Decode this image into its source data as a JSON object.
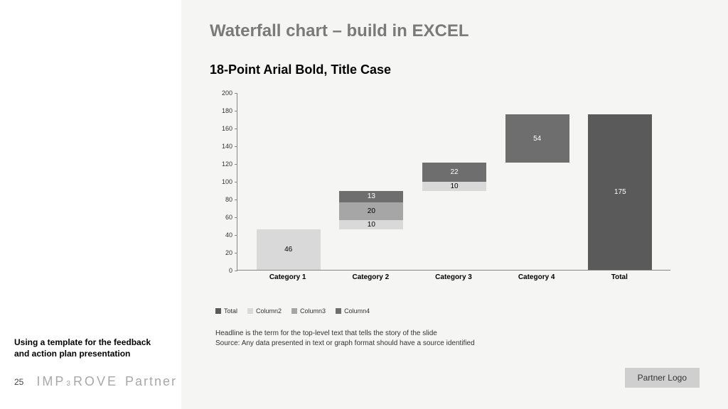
{
  "sidebar": {
    "caption": "Using a template for the feedback and action plan presentation",
    "page_number": "25",
    "brand_p1": "IMP",
    "brand_sup": "3",
    "brand_p2": "ROVE",
    "brand_partner": "Partner"
  },
  "slide": {
    "title": "Waterfall chart – build in EXCEL",
    "chart_title": "18-Point Arial Bold, Title Case",
    "headline_note": "Headline is the term for the top-level  text that tells the story of the slide",
    "source_note": "Source: Any data presented in text or graph format should have a source identified",
    "partner_logo": "Partner Logo"
  },
  "legend": {
    "items": [
      {
        "label": "Total",
        "color": "#5a5a5a"
      },
      {
        "label": "Column2",
        "color": "#d9d9d9"
      },
      {
        "label": "Column3",
        "color": "#a6a6a6"
      },
      {
        "label": "Column4",
        "color": "#6e6e6e"
      }
    ]
  },
  "chart_data": {
    "type": "bar",
    "title": "18-Point Arial Bold, Title Case",
    "xlabel": "",
    "ylabel": "",
    "ylim": [
      0,
      200
    ],
    "yticks": [
      0,
      20,
      40,
      60,
      80,
      100,
      120,
      140,
      160,
      180,
      200
    ],
    "categories": [
      "Category 1",
      "Category 2",
      "Category 3",
      "Category 4",
      "Total"
    ],
    "series": [
      {
        "name": "invisible_base",
        "color": "transparent",
        "values": [
          0,
          46,
          89,
          121,
          0
        ],
        "labels": [
          "",
          "",
          "",
          "",
          ""
        ]
      },
      {
        "name": "Column2",
        "color": "#d9d9d9",
        "values": [
          46,
          10,
          10,
          0,
          0
        ],
        "labels": [
          "46",
          "10",
          "10",
          "",
          ""
        ]
      },
      {
        "name": "Column3",
        "color": "#a6a6a6",
        "values": [
          0,
          20,
          0,
          0,
          0
        ],
        "labels": [
          "",
          "20",
          "",
          "",
          ""
        ]
      },
      {
        "name": "Column4",
        "color": "#6e6e6e",
        "values": [
          0,
          13,
          22,
          54,
          0
        ],
        "labels": [
          "",
          "13",
          "22",
          "54",
          ""
        ]
      },
      {
        "name": "Total",
        "color": "#5a5a5a",
        "values": [
          0,
          0,
          0,
          0,
          175
        ],
        "labels": [
          "",
          "",
          "",
          "",
          "175"
        ]
      }
    ],
    "legend": [
      "Total",
      "Column2",
      "Column3",
      "Column4"
    ]
  }
}
